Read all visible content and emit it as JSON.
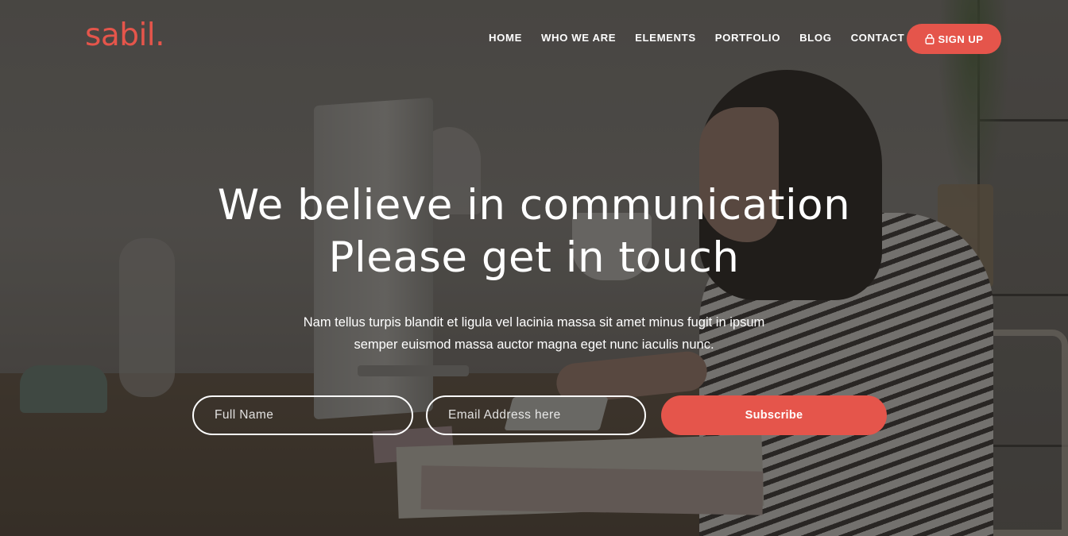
{
  "brand": {
    "logo_text": "sabil.",
    "accent_color": "#e5554b"
  },
  "nav": {
    "items": [
      {
        "label": "HOME"
      },
      {
        "label": "WHO WE ARE"
      },
      {
        "label": "ELEMENTS"
      },
      {
        "label": "PORTFOLIO"
      },
      {
        "label": "BLOG"
      },
      {
        "label": "CONTACT"
      }
    ],
    "signup": {
      "label": "SIGN UP",
      "icon": "lock-icon"
    }
  },
  "hero": {
    "headline_line1": "We believe in communication",
    "headline_line2": "Please get in touch",
    "subtext_line1": "Nam tellus turpis blandit et ligula vel lacinia massa sit amet minus fugit in ipsum",
    "subtext_line2": "semper euismod massa auctor magna eget nunc iaculis nunc."
  },
  "form": {
    "name_placeholder": "Full Name",
    "name_value": "",
    "email_placeholder": "Email Address here",
    "email_value": "",
    "subscribe_label": "Subscribe"
  }
}
